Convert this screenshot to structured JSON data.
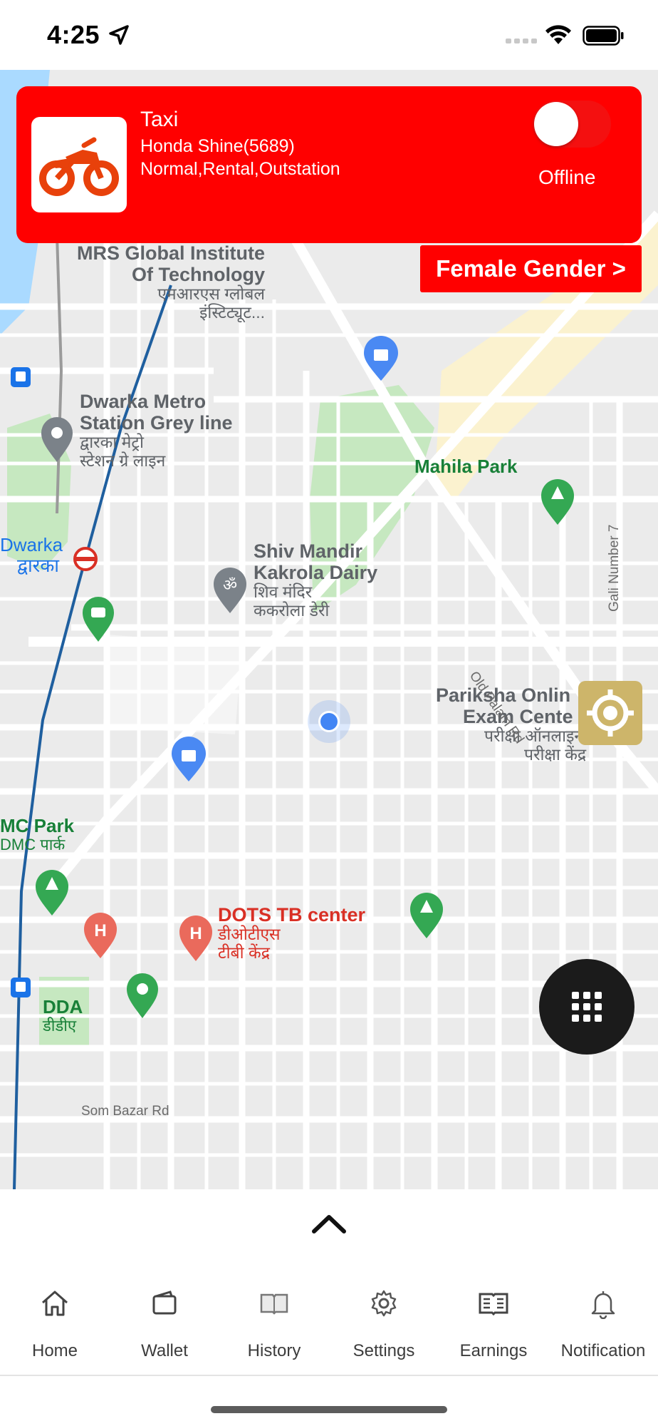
{
  "status_bar": {
    "time": "4:25"
  },
  "vehicle_card": {
    "type": "Taxi",
    "model": "Honda Shine(5689)",
    "services": "Normal,Rental,Outstation",
    "status_label": "Offline",
    "online": false
  },
  "gender_button": {
    "label": "Female Gender >"
  },
  "map": {
    "places": {
      "mrs_line1": "MRS Global Institute",
      "mrs_line2": "Of Technology",
      "mrs_hindi1": "एमआरएस ग्लोबल",
      "mrs_hindi2": "इंस्टिट्यूट...",
      "metro_line1": "Dwarka Metro",
      "metro_line2": "Station Grey line",
      "metro_hindi1": "द्वारका मेट्रो",
      "metro_hindi2": "स्टेशन ग्रे लाइन",
      "mahila_park": "Mahila Park",
      "shiv_line1": "Shiv Mandir",
      "shiv_line2": "Kakrola Dairy",
      "shiv_hindi1": "शिव मंदिर",
      "shiv_hindi2": "ककरोला डेरी",
      "dwarka": "Dwarka",
      "dwarka_hindi": "द्वारका",
      "pariksha_line1": "Pariksha Onlin",
      "pariksha_line2": "Exam Cente",
      "pariksha_hindi1": "परीक्षा ऑनलाइन",
      "pariksha_hindi2": "परीक्षा केंद्र",
      "dmc_park": "MC Park",
      "dmc_hindi": "DMC पार्क",
      "dots": "DOTS TB center",
      "dots_hindi1": "डीओटीएस",
      "dots_hindi2": "टीबी केंद्र",
      "dda": "DDA",
      "dda_hindi": "डीडीए",
      "som_bazar": "Som Bazar Rd",
      "old_palam": "Old Palam Rd",
      "gali7": "Gali Number 7"
    }
  },
  "tabs": [
    {
      "label": "Home",
      "icon": "home-icon"
    },
    {
      "label": "Wallet",
      "icon": "wallet-icon"
    },
    {
      "label": "History",
      "icon": "book-icon"
    },
    {
      "label": "Settings",
      "icon": "gear-icon"
    },
    {
      "label": "Earnings",
      "icon": "earnings-icon"
    },
    {
      "label": "Notification",
      "icon": "bell-icon"
    }
  ]
}
